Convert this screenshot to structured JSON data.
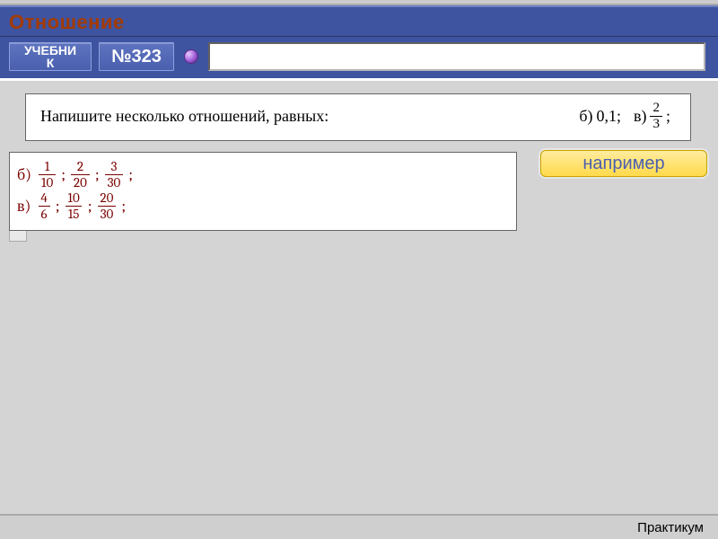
{
  "header": {
    "title": "Отношение"
  },
  "toolbar": {
    "textbook_label_line1": "УЧЕБНИ",
    "textbook_label_line2": "К",
    "number_label": "№323",
    "sphere_icon": "violet-sphere"
  },
  "problem": {
    "text": "Напишите несколько отношений, равных:",
    "part_b_label": "б)",
    "part_b_value": "0,1;",
    "part_c_label": "в)"
  },
  "problem_fraction_v": {
    "num": "2",
    "den": "3",
    "tail": ";"
  },
  "answers": {
    "b": {
      "label": "б)",
      "fractions": [
        {
          "num": "1",
          "den": "10"
        },
        {
          "num": "2",
          "den": "20"
        },
        {
          "num": "3",
          "den": "30"
        }
      ]
    },
    "v": {
      "label": "в)",
      "fractions": [
        {
          "num": "4",
          "den": "6"
        },
        {
          "num": "10",
          "den": "15"
        },
        {
          "num": "20",
          "den": "30"
        }
      ]
    },
    "sep": ";"
  },
  "example_button": "например",
  "footer": "Практикум"
}
